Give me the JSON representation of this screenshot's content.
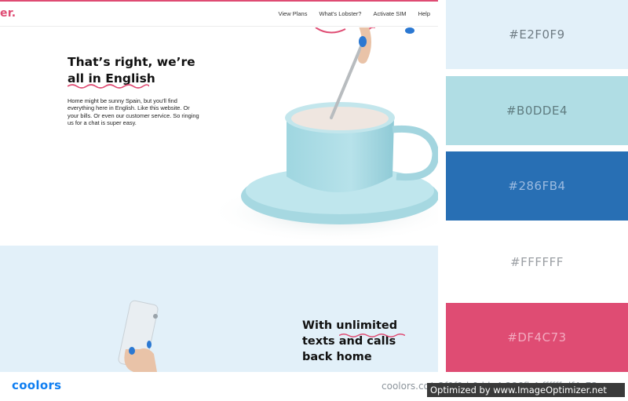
{
  "site": {
    "logo": "er.",
    "nav": [
      "View Plans",
      "What's Lobster?",
      "Activate SIM",
      "Help"
    ],
    "hero_title_line1": "That’s right, we’re",
    "hero_title_line2": "all in English",
    "hero_body": "Home might be sunny Spain, but you'll find everything here in English. Like this website. Or your bills. Or even our customer service. So ringing us for a chat is super easy.",
    "section2_title_pre": "With ",
    "section2_title_highlight": "unlimited",
    "section2_title_line2": "texts and calls",
    "section2_title_line3": "back home"
  },
  "palette": {
    "swatches": [
      {
        "hex_label": "#E2F0F9",
        "color": "#e2f0f9"
      },
      {
        "hex_label": "#B0DDE4",
        "color": "#b0dde4"
      },
      {
        "hex_label": "#286FB4",
        "color": "#286fb4"
      },
      {
        "hex_label": "#FFFFFF",
        "color": "#ffffff"
      },
      {
        "hex_label": "#DF4C73",
        "color": "#df4c73"
      }
    ]
  },
  "footer": {
    "brand": "coolors",
    "url": "coolors.co/e2f0f9-b0dde4-286fb4-ffffff-df4c73",
    "watermark": "Optimized by www.ImageOptimizer.net"
  },
  "colors": {
    "accent_pink": "#df4c73",
    "brand_blue": "#0f7ef1"
  },
  "icons": [
    "teacup-illustration",
    "phone-hand-illustration",
    "squiggle-underline"
  ]
}
